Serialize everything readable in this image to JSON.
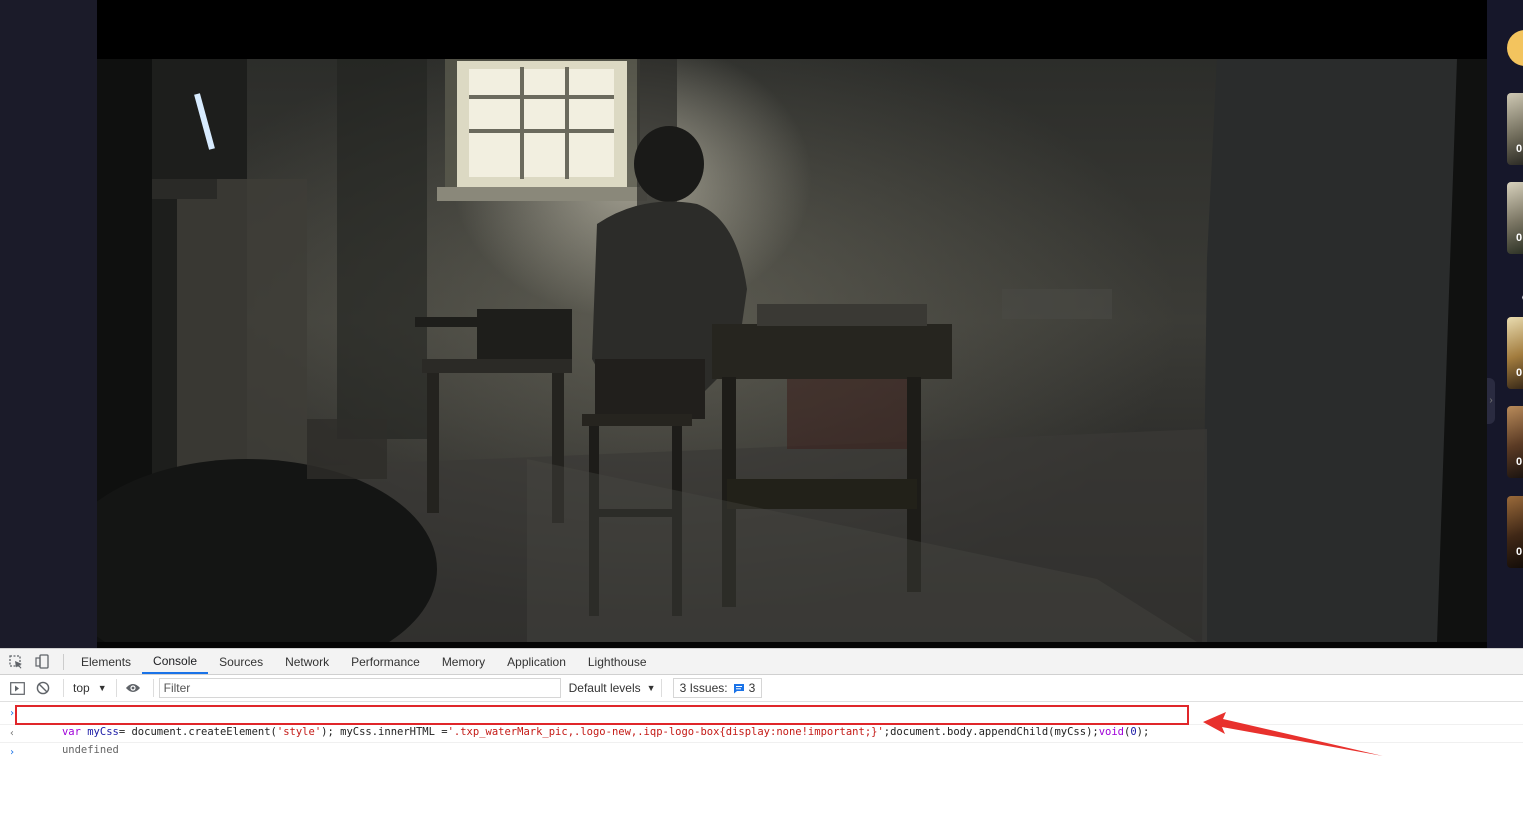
{
  "devtools": {
    "tabs": [
      {
        "label": "Elements"
      },
      {
        "label": "Console"
      },
      {
        "label": "Sources"
      },
      {
        "label": "Network"
      },
      {
        "label": "Performance"
      },
      {
        "label": "Memory"
      },
      {
        "label": "Application"
      },
      {
        "label": "Lighthouse"
      }
    ],
    "active_tab": "Console",
    "toolbar": {
      "context": "top",
      "filter_placeholder": "Filter",
      "levels": "Default levels",
      "issues_label": "3 Issues:",
      "issues_count": "3"
    },
    "console": {
      "input": {
        "k1": "var",
        "v1": "myCss",
        "p1": "= document.createElement(",
        "s1": "'style'",
        "p2": "); myCss.innerHTML =",
        "s2": "'.txp_waterMark_pic,.logo-new,.iqp-logo-box{display:none!important;}'",
        "p3": ";document.body.appendChild(myCss);",
        "k2": "void",
        "p4": "(",
        "n1": "0",
        "p5": ");"
      },
      "result": "undefined"
    }
  },
  "sidebar": {
    "thumbs": [
      {
        "label": "0"
      },
      {
        "label": "0"
      },
      {
        "label": "0"
      },
      {
        "label": "0"
      },
      {
        "label": "0"
      }
    ],
    "collapse_glyph": "《"
  },
  "colors": {
    "highlight": "#e0262a",
    "accent": "#1a73e8"
  }
}
